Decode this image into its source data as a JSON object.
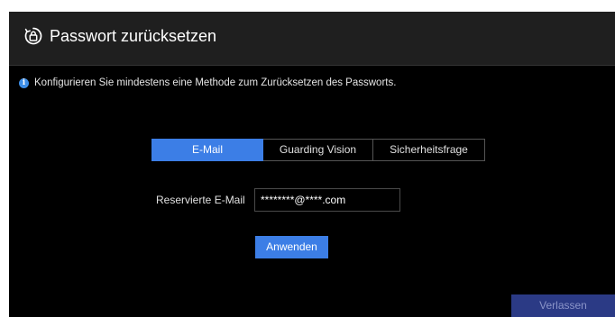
{
  "dialog": {
    "title": "Passwort zurücksetzen",
    "title_icon": "lock-reset-icon",
    "info_icon": "info-icon",
    "info_text": "Konfigurieren Sie mindestens eine Methode zum Zurücksetzen des Passworts."
  },
  "tabs": [
    {
      "label": "E-Mail",
      "active": true
    },
    {
      "label": "Guarding Vision",
      "active": false
    },
    {
      "label": "Sicherheitsfrage",
      "active": false
    }
  ],
  "email_field": {
    "label": "Reservierte E-Mail",
    "value": "********@****.com"
  },
  "buttons": {
    "apply": "Anwenden",
    "exit": "Verlassen"
  },
  "colors": {
    "accent": "#3c7ee6",
    "exit_button": "#2b3a85",
    "info_icon": "#3d8ee8",
    "background": "#000000",
    "titlebar": "#1f1f1f"
  }
}
